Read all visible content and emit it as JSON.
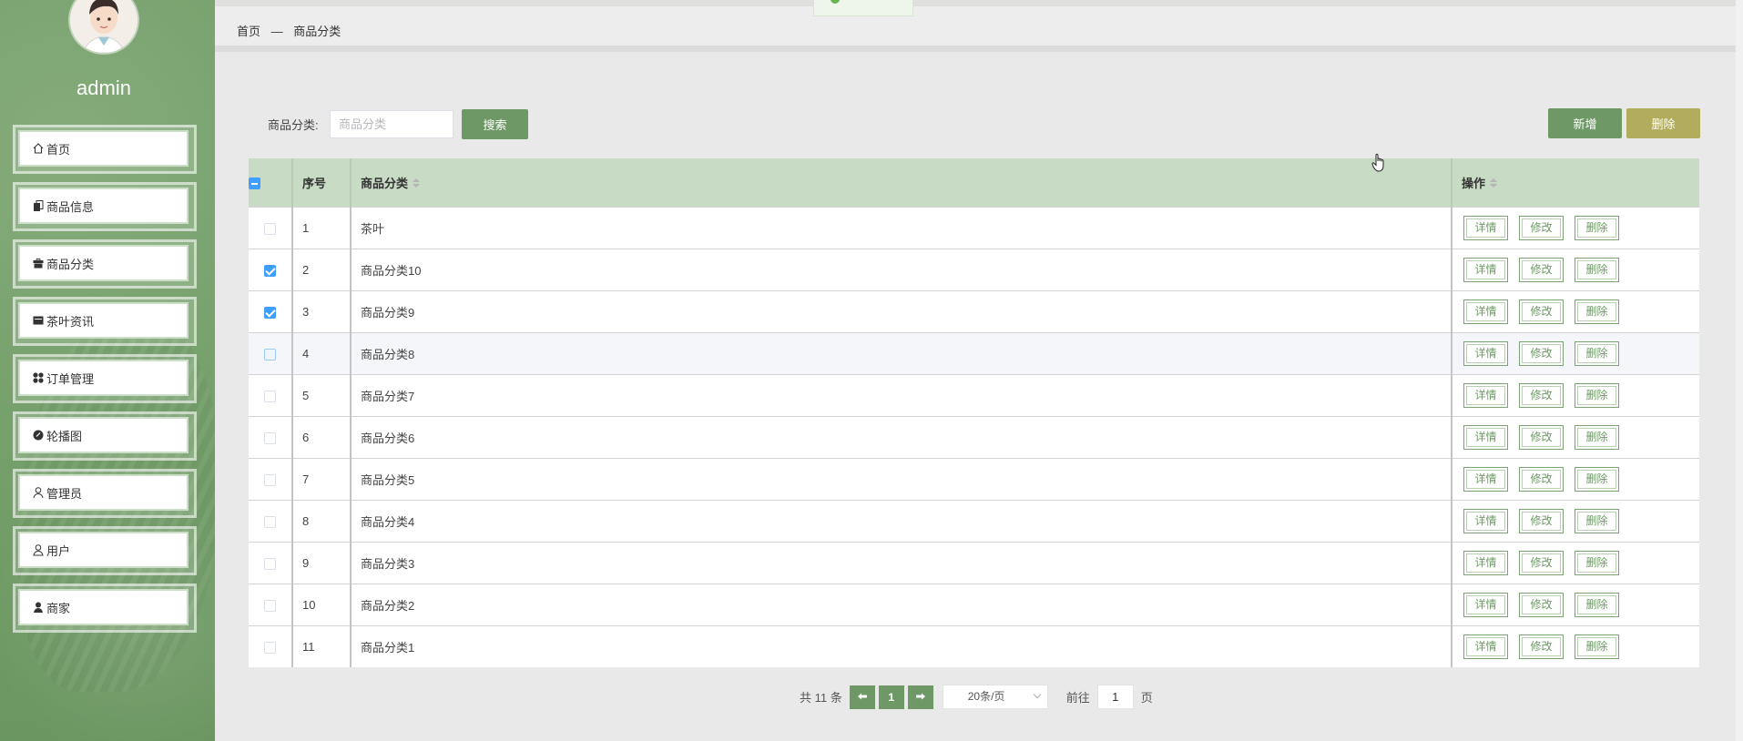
{
  "sidebar": {
    "username": "admin",
    "items": [
      {
        "label": "首页",
        "icon": "home-icon"
      },
      {
        "label": "商品信息",
        "icon": "product-icon"
      },
      {
        "label": "商品分类",
        "icon": "category-icon"
      },
      {
        "label": "茶叶资讯",
        "icon": "news-icon"
      },
      {
        "label": "订单管理",
        "icon": "order-icon"
      },
      {
        "label": "轮播图",
        "icon": "carousel-icon"
      },
      {
        "label": "管理员",
        "icon": "admin-user-icon"
      },
      {
        "label": "用户",
        "icon": "user-icon"
      },
      {
        "label": "商家",
        "icon": "merchant-icon"
      }
    ]
  },
  "header": {
    "breadcrumb": {
      "home": "首页",
      "separator": "—",
      "current": "商品分类"
    }
  },
  "search": {
    "label": "商品分类:",
    "placeholder": "商品分类",
    "value": "",
    "button": "搜索"
  },
  "toolbar": {
    "add": "新增",
    "delete": "删除"
  },
  "table": {
    "columns": {
      "index": "序号",
      "category": "商品分类",
      "actions": "操作"
    },
    "action_labels": {
      "detail": "详情",
      "edit": "修改",
      "delete": "删除"
    },
    "rows": [
      {
        "index": "1",
        "category": "茶叶",
        "checked": false
      },
      {
        "index": "2",
        "category": "商品分类10",
        "checked": true
      },
      {
        "index": "3",
        "category": "商品分类9",
        "checked": true
      },
      {
        "index": "4",
        "category": "商品分类8",
        "checked": false
      },
      {
        "index": "5",
        "category": "商品分类7",
        "checked": false
      },
      {
        "index": "6",
        "category": "商品分类6",
        "checked": false
      },
      {
        "index": "7",
        "category": "商品分类5",
        "checked": false
      },
      {
        "index": "8",
        "category": "商品分类4",
        "checked": false
      },
      {
        "index": "9",
        "category": "商品分类3",
        "checked": false
      },
      {
        "index": "10",
        "category": "商品分类2",
        "checked": false
      },
      {
        "index": "11",
        "category": "商品分类1",
        "checked": false
      }
    ]
  },
  "pagination": {
    "total": "共 11 条",
    "current_page": "1",
    "page_size": "20条/页",
    "goto_label": "前往",
    "goto_value": "1",
    "goto_unit": "页"
  },
  "colors": {
    "accent": "#6e9966",
    "delete_button": "#b1ad5d",
    "table_header": "#c8dbc4",
    "checkbox": "#409eff"
  }
}
